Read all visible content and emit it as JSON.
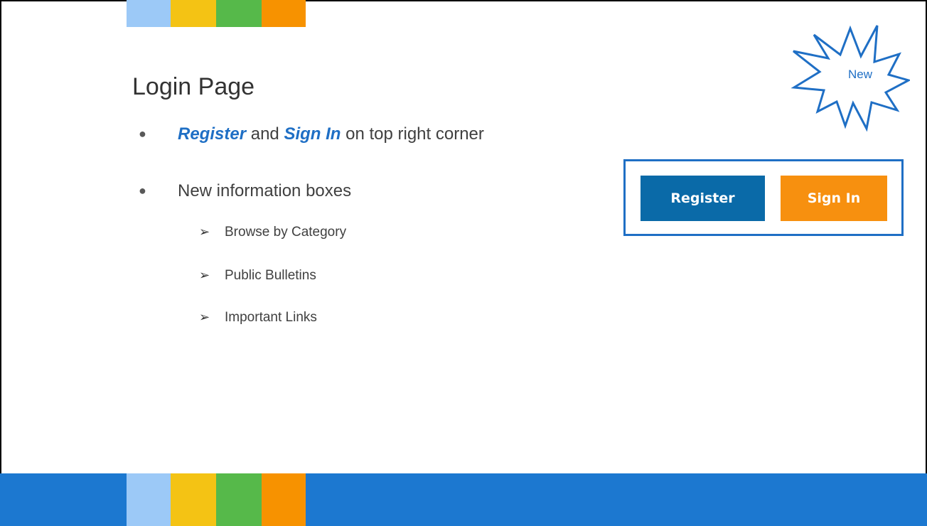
{
  "slide": {
    "title": "Login Page",
    "bullets": [
      {
        "emphasis_1": "Register",
        "connector": " and ",
        "emphasis_2": "Sign In",
        "rest": " on top right corner"
      },
      {
        "text": "New information boxes"
      }
    ],
    "sub_items": [
      "Browse by Category",
      "Public Bulletins",
      "Important Links"
    ],
    "sub_item_marker": "➢",
    "bullet_marker": "●"
  },
  "callout": {
    "starburst_label": "New",
    "register_label": "Register",
    "signin_label": "Sign In"
  },
  "colors": {
    "light_blue": "#9cc9f7",
    "yellow": "#f4c314",
    "green": "#56b94a",
    "orange": "#f79200",
    "bottom_blue": "#1c78d0",
    "register_button": "#0a6aa8",
    "signin_button": "#f7900f",
    "accent_blue": "#1f6fc5"
  }
}
